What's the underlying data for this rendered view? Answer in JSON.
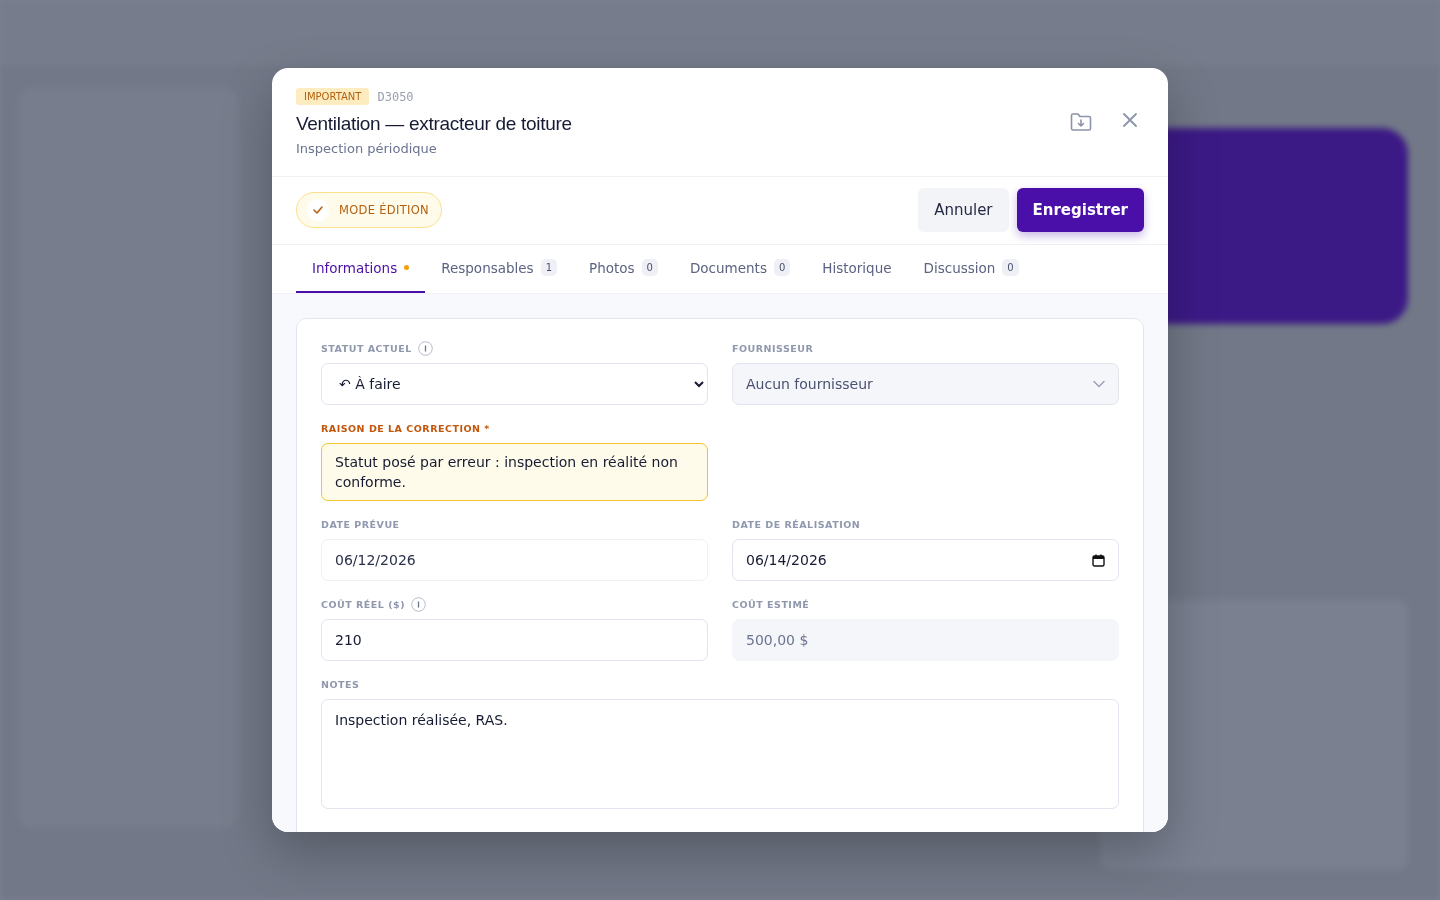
{
  "modal": {
    "badge": "IMPORTANT",
    "code": "D3050",
    "title": "Ventilation — extracteur de toiture",
    "subtitle": "Inspection périodique",
    "edit_mode": {
      "label": "MODE ÉDITION",
      "on": true
    },
    "buttons": [
      {
        "label": "Annuler",
        "kind": "secondary"
      },
      {
        "label": "Enregistrer",
        "kind": "primary"
      }
    ],
    "tabs": [
      {
        "label": "Informations",
        "selected": true,
        "dot": true
      },
      {
        "label": "Responsables",
        "count": "1",
        "selected": false
      },
      {
        "label": "Photos",
        "count": "0",
        "selected": false
      },
      {
        "label": "Documents",
        "count": "0",
        "selected": false
      },
      {
        "label": "Historique",
        "selected": false
      },
      {
        "label": "Discussion",
        "count": "0",
        "selected": false
      }
    ],
    "rows": [
      [
        {
          "label": "STATUT ACTUEL",
          "info": true,
          "kind": "select",
          "value": "↶ À faire"
        },
        {
          "label": "FOURNISSEUR",
          "kind": "dropdown",
          "value": "Aucun fournisseur"
        }
      ],
      [
        {
          "label": "RAISON DE LA CORRECTION *",
          "kind": "warning",
          "value": "Statut posé par erreur : inspection en réalité non conforme."
        }
      ],
      [
        {
          "label": "DATE PRÉVUE",
          "kind": "plain",
          "value": "06/12/2026"
        },
        {
          "label": "DATE DE RÉALISATION",
          "kind": "date",
          "value": "06/14/2026"
        }
      ],
      [
        {
          "label": "COÛT RÉEL ($)",
          "info": true,
          "kind": "input",
          "value": "210"
        },
        {
          "label": "COÛT ESTIMÉ",
          "kind": "readonly",
          "value": "500,00 $"
        }
      ],
      [
        {
          "label": "NOTES",
          "kind": "textarea",
          "value": "Inspection réalisée, RAS."
        }
      ]
    ]
  }
}
